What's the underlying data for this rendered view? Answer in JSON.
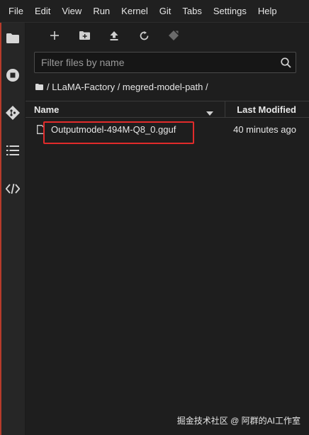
{
  "menubar": {
    "items": [
      "File",
      "Edit",
      "View",
      "Run",
      "Kernel",
      "Git",
      "Tabs",
      "Settings",
      "Help"
    ]
  },
  "leftbar": {
    "icons": [
      "folder-icon",
      "running-icon",
      "git-icon",
      "table-of-contents-icon",
      "extensions-icon"
    ]
  },
  "toolbar": {
    "buttons": [
      "new-launcher",
      "new-folder",
      "upload",
      "refresh",
      "git-clone"
    ]
  },
  "search": {
    "placeholder": "Filter files by name",
    "value": ""
  },
  "breadcrumb": {
    "text": "/ LLaMA-Factory / megred-model-path /"
  },
  "file_list": {
    "header_name": "Name",
    "header_modified": "Last Modified",
    "rows": [
      {
        "name": "Outputmodel-494M-Q8_0.gguf",
        "modified": "40 minutes ago"
      }
    ]
  },
  "colors": {
    "background": "#1e1e1e",
    "accent_red": "#e12b2b",
    "leftbar_edge": "#b73b2b"
  },
  "watermark": {
    "text": "掘金技术社区 @ 阿群的AI工作室"
  }
}
